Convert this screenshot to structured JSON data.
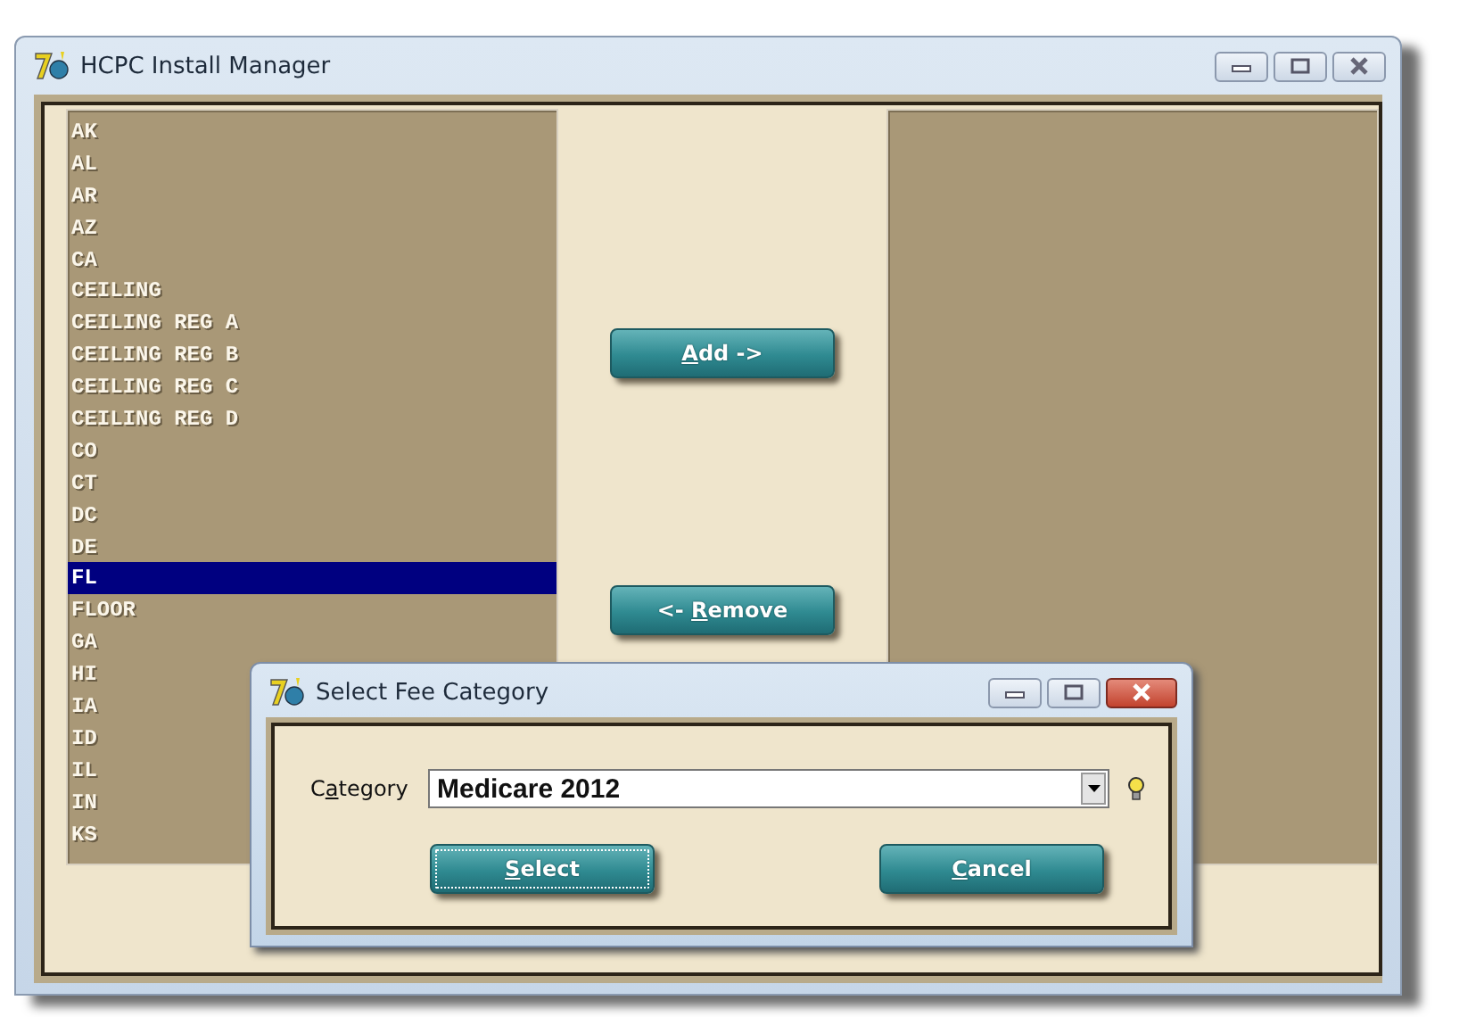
{
  "window": {
    "title": "HCPC Install Manager"
  },
  "available_list": {
    "items": [
      {
        "label": "AK",
        "selected": false
      },
      {
        "label": "AL",
        "selected": false
      },
      {
        "label": "AR",
        "selected": false
      },
      {
        "label": "AZ",
        "selected": false
      },
      {
        "label": "CA",
        "selected": false
      },
      {
        "label": "CEILING",
        "selected": false
      },
      {
        "label": "CEILING REG A",
        "selected": false
      },
      {
        "label": "CEILING REG B",
        "selected": false
      },
      {
        "label": "CEILING REG C",
        "selected": false
      },
      {
        "label": "CEILING REG D",
        "selected": false
      },
      {
        "label": "CO",
        "selected": false
      },
      {
        "label": "CT",
        "selected": false
      },
      {
        "label": "DC",
        "selected": false
      },
      {
        "label": "DE",
        "selected": false
      },
      {
        "label": "FL",
        "selected": true
      },
      {
        "label": "FLOOR",
        "selected": false
      },
      {
        "label": "GA",
        "selected": false
      },
      {
        "label": "HI",
        "selected": false
      },
      {
        "label": "IA",
        "selected": false
      },
      {
        "label": "ID",
        "selected": false
      },
      {
        "label": "IL",
        "selected": false
      },
      {
        "label": "IN",
        "selected": false
      },
      {
        "label": "KS",
        "selected": false
      }
    ]
  },
  "buttons": [
    {
      "key": "A",
      "after": "dd ->"
    },
    {
      "before": "<- ",
      "key": "R",
      "after": "emove"
    }
  ],
  "dialog": {
    "title": "Select Fee Category",
    "category_label": {
      "before": "C",
      "key": "a",
      "after": "tegory"
    },
    "category_value": "Medicare 2012",
    "buttons": [
      {
        "key": "S",
        "after": "elect",
        "focused": true
      },
      {
        "key": "C",
        "after": "ancel",
        "focused": false
      }
    ]
  }
}
